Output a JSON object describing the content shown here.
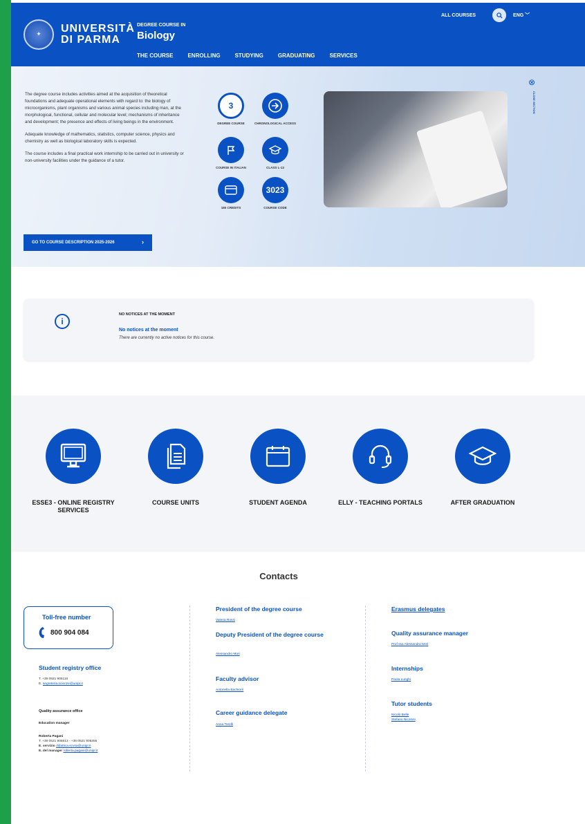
{
  "header": {
    "logo_line1": "UNIVERSITÀ",
    "logo_line2": "DI PARMA",
    "degree_label": "DEGREE COURSE IN",
    "degree_name": "Biology",
    "nav": [
      "THE COURSE",
      "ENROLLING",
      "STUDYING",
      "GRADUATING",
      "SERVICES"
    ],
    "all_courses": "ALL COURSES",
    "lang": "ENG",
    "search_icon": "search-icon"
  },
  "hero": {
    "paragraphs": [
      "The degree course includes activities aimed at the acquisition of theoretical foundations and adequate operational elements with regard to: the biology of microorganisms, plant organisms and various animal species including man, at the morphological, functional, cellular and molecular level; mechanisms of inheritance and development; the presence and effects of living beings in the environment.",
      "Adequate knowledge of mathematics, statistics, computer science, physics and chemistry as well as biological laboratory skills is expected.",
      "The course includes a final practical work internship to be carried out in university or non-university facilities under the guidance of a tutor."
    ],
    "button_label": "GO TO COURSE DESCRIPTION 2025-2026",
    "close_label": "CLOSE SECTION",
    "facts": [
      {
        "value": "3",
        "label": "DEGREE COURSE",
        "icon": "years-ring-icon"
      },
      {
        "value": "",
        "label": "CHRONOLOGICAL ACCESS",
        "icon": "arrow-right-circle-icon"
      },
      {
        "value": "",
        "label": "COURSE IN ITALIAN",
        "icon": "flag-icon"
      },
      {
        "value": "",
        "label": "CLASS L-13",
        "icon": "graduation-cap-icon"
      },
      {
        "value": "",
        "label": "180 CREDITS",
        "icon": "card-icon"
      },
      {
        "value": "3023",
        "label": "COURSE CODE",
        "icon": "code-badge-icon"
      }
    ]
  },
  "notices": {
    "title": "NO NOTICES AT THE MOMENT",
    "subtitle": "No notices at the moment",
    "description": "There are currently no active notices for this course."
  },
  "services": [
    {
      "label": "ESSE3 - ONLINE REGISTRY SERVICES",
      "icon": "monitor-icon"
    },
    {
      "label": "COURSE UNITS",
      "icon": "document-icon"
    },
    {
      "label": "STUDENT AGENDA",
      "icon": "calendar-icon"
    },
    {
      "label": "ELLY - TEACHING PORTALS",
      "icon": "headset-icon"
    },
    {
      "label": "AFTER GRADUATION",
      "icon": "graduation-cap-icon"
    }
  ],
  "contacts": {
    "title": "Contacts",
    "tollfree_label": "Toll-free number",
    "tollfree_number": "800 904 084",
    "registry_title": "Student registry office",
    "registry_phone": "T. +39 0521 905116",
    "registry_email_prefix": "E.",
    "registry_email": "segreteria.scienze@unipr.it",
    "qa_office": "Quality assurance office",
    "edu_manager": "Education manager",
    "manager_name": "Roberta Pagani",
    "manager_phone": "T. +39 0521 905613 - +39 0521 905355",
    "service_email_prefix": "E. servizio",
    "service_email": "didattica.scvsa@unipr.it",
    "manager_email_prefix": "E. del manager",
    "manager_email": "roberta.pagani@unipr.it",
    "col2": [
      {
        "title": "President of the degree course",
        "name": "Valeria Rossi"
      },
      {
        "title": "Deputy President of the degree course",
        "name": "Alessandro Mori"
      },
      {
        "title": "Faculty advisor",
        "name": "Antonella Bachiorri"
      },
      {
        "title": "Career guidance delegate",
        "name": "Anna Torelli"
      }
    ],
    "col3": [
      {
        "title": "Erasmus delegates",
        "names": []
      },
      {
        "title": "Quality assurance manager",
        "names": [
          "Prof.ssa Alessandra Mori"
        ]
      },
      {
        "title": "Internships",
        "names": [
          "Paola Lunghi"
        ]
      },
      {
        "title": "Tutor students",
        "names": [
          "Nicolò Belle",
          "Stefano Nicolosi"
        ]
      }
    ]
  },
  "colors": {
    "brand_blue": "#0a52c4",
    "accent_green": "#1ea04a",
    "panel_grey": "#f3f5f8"
  }
}
